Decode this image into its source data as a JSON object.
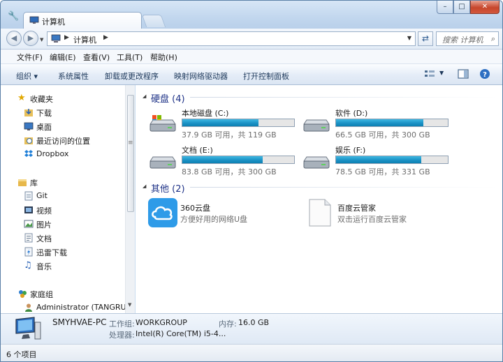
{
  "window": {
    "tab_title": "计算机"
  },
  "address": {
    "crumb": "计算机",
    "search_placeholder": "搜索 计算机"
  },
  "menu": {
    "file": "文件(F)",
    "edit": "编辑(E)",
    "view": "查看(V)",
    "tools": "工具(T)",
    "help": "帮助(H)"
  },
  "commands": {
    "organize": "组织",
    "system_properties": "系统属性",
    "uninstall": "卸载或更改程序",
    "map_drive": "映射网络驱动器",
    "control_panel": "打开控制面板"
  },
  "sidebar": {
    "favorites": {
      "label": "收藏夹",
      "items": [
        "下载",
        "桌面",
        "最近访问的位置",
        "Dropbox"
      ]
    },
    "libraries": {
      "label": "库",
      "items": [
        "Git",
        "视频",
        "图片",
        "文档",
        "迅雷下载",
        "音乐"
      ]
    },
    "homegroup": {
      "label": "家庭组",
      "items": [
        "Administrator (TANGRUI)"
      ]
    }
  },
  "main": {
    "hard_disks_header": "硬盘 (4)",
    "drives": [
      {
        "name": "本地磁盘 (C:)",
        "space": "37.9 GB 可用，共 119 GB",
        "used_fraction": 0.68
      },
      {
        "name": "软件 (D:)",
        "space": "66.5 GB 可用，共 300 GB",
        "used_fraction": 0.78
      },
      {
        "name": "文档 (E:)",
        "space": "83.8 GB 可用，共 300 GB",
        "used_fraction": 0.72
      },
      {
        "name": "娱乐 (F:)",
        "space": "78.5 GB 可用，共 331 GB",
        "used_fraction": 0.76
      }
    ],
    "other_header": "其他 (2)",
    "others": [
      {
        "name": "360云盘",
        "sub": "方便好用的网络U盘"
      },
      {
        "name": "百度云管家",
        "sub": "双击运行百度云管家"
      }
    ]
  },
  "details": {
    "pc_name": "SMYHVAE-PC",
    "workgroup_label": "工作组:",
    "workgroup_value": "WORKGROUP",
    "memory_label": "内存:",
    "memory_value": "16.0 GB",
    "cpu_label": "处理器:",
    "cpu_value": "Intel(R) Core(TM) i5-4..."
  },
  "status": {
    "item_count": "6 个项目"
  },
  "colors": {
    "drive_bar": "#1e95c8",
    "group_header": "#1e3287",
    "close_button": "#c7462c"
  }
}
